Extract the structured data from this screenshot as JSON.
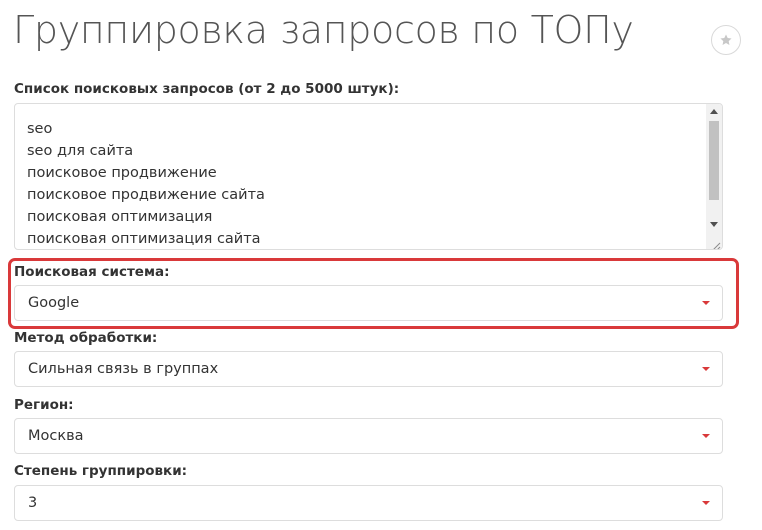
{
  "page": {
    "title": "Группировка запросов по ТОПу",
    "favorite_icon": "star-icon"
  },
  "queries": {
    "label": "Список поисковых запросов (от 2 до 5000 штук):",
    "lines": [
      "seo",
      "seo для сайта",
      "поисковое продвижение",
      "поисковое продвижение сайта",
      "поисковая оптимизация",
      "поисковая оптимизация сайта"
    ]
  },
  "search_engine": {
    "label": "Поисковая система:",
    "value": "Google"
  },
  "method": {
    "label": "Метод обработки:",
    "value": "Сильная связь в группах"
  },
  "region": {
    "label": "Регион:",
    "value": "Москва"
  },
  "grouping_level": {
    "label": "Степень группировки:",
    "value": "3"
  },
  "colors": {
    "accent": "#d9393a",
    "highlight_frame": "#d9393a",
    "text": "#333333",
    "title": "#555555",
    "border": "#dddddd"
  }
}
